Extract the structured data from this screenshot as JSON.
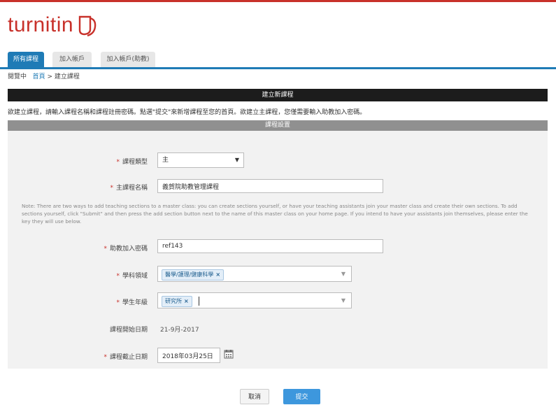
{
  "brand": {
    "name": "turnitin",
    "color": "#c8312a",
    "icon": "turnitin-logo-icon"
  },
  "tabs": [
    {
      "label": "所有課程",
      "active": true
    },
    {
      "label": "加入帳戶",
      "active": false
    },
    {
      "label": "加入帳戶(助教)",
      "active": false
    }
  ],
  "breadcrumb": {
    "prefix": "閱覽中",
    "home": "首頁",
    "separator": ">",
    "current": "建立課程"
  },
  "banner": {
    "title": "建立新課程"
  },
  "intro_text": "欲建立課程，請輸入課程名稱和課程註冊密碼。點選\"提交\"來新增課程至您的首頁。欲建立主課程，您僅需要輸入助教加入密碼。",
  "panel": {
    "title": "課程設置",
    "course_type": {
      "label": "課程類型",
      "value": "主"
    },
    "master_course_name": {
      "label": "主課程名稱",
      "value": "義賀院助教管理課程"
    },
    "note": "Note: There are two ways to add teaching sections to a master class: you can create sections yourself, or have your teaching assistants join your master class and create their own sections. To add sections yourself, click \"Submit\" and then press the add section button next to the name of this master class on your home page. If you intend to have your assistants join themselves, please enter the key they will use below.",
    "ta_join_key": {
      "label": "助教加入密碼",
      "value": "ref143"
    },
    "subject_area": {
      "label": "學科領域",
      "chips": [
        "醫學/護理/健康科學"
      ]
    },
    "student_level": {
      "label": "學生年級",
      "chips": [
        "研究所"
      ]
    },
    "start_date": {
      "label": "課程開始日期",
      "value": "21-9月-2017"
    },
    "end_date": {
      "label": "課程截止日期",
      "value": "2018年03月25日",
      "icon": "calendar-icon"
    }
  },
  "buttons": {
    "cancel": "取消",
    "submit": "提交"
  },
  "colors": {
    "accent": "#1f7bb6",
    "banner": "#1c1c1c",
    "submit": "#3d97dd"
  }
}
